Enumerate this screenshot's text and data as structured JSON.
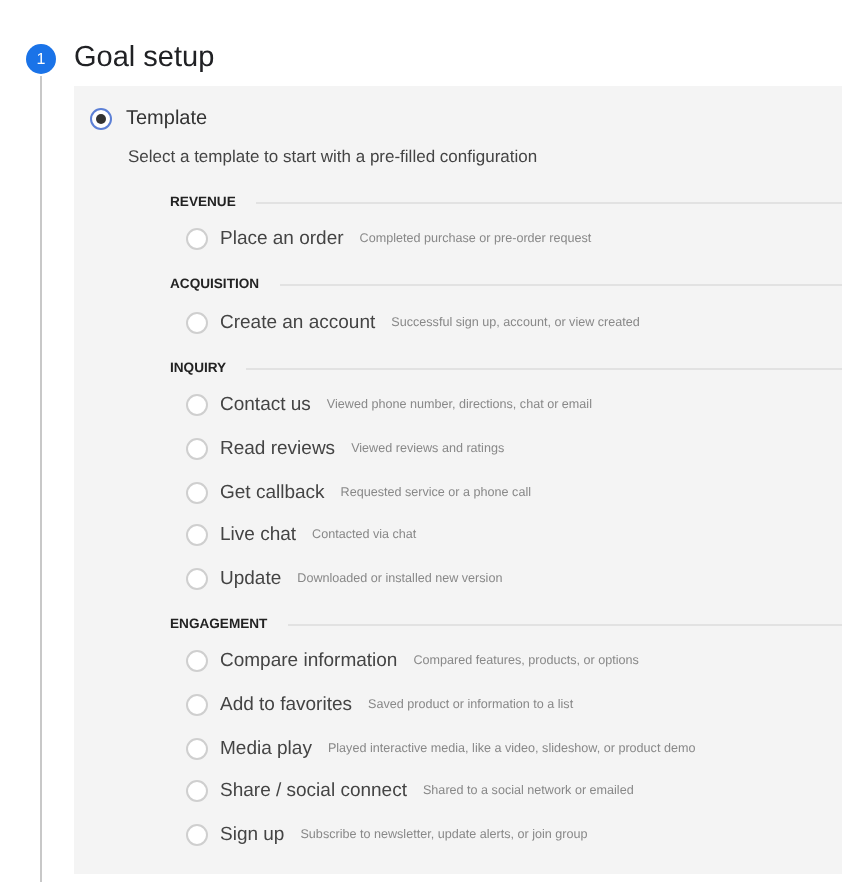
{
  "step": {
    "number": "1",
    "title": "Goal setup"
  },
  "template_option": {
    "label": "Template",
    "selected": true
  },
  "instruction": "Select a template to start with a pre-filled configuration",
  "categories": [
    {
      "title": "REVENUE",
      "options": [
        {
          "label": "Place an order",
          "description": "Completed purchase or pre-order request",
          "selected": false
        }
      ]
    },
    {
      "title": "ACQUISITION",
      "options": [
        {
          "label": "Create an account",
          "description": "Successful sign up, account, or view created",
          "selected": false
        }
      ]
    },
    {
      "title": "INQUIRY",
      "options": [
        {
          "label": "Contact us",
          "description": "Viewed phone number, directions, chat or email",
          "selected": false
        },
        {
          "label": "Read reviews",
          "description": "Viewed reviews and ratings",
          "selected": false
        },
        {
          "label": "Get callback",
          "description": "Requested service or a phone call",
          "selected": false
        },
        {
          "label": "Live chat",
          "description": "Contacted via chat",
          "selected": false
        },
        {
          "label": "Update",
          "description": "Downloaded or installed new version",
          "selected": false
        }
      ]
    },
    {
      "title": "ENGAGEMENT",
      "options": [
        {
          "label": "Compare information",
          "description": "Compared features, products, or options",
          "selected": false
        },
        {
          "label": "Add to favorites",
          "description": "Saved product or information to a list",
          "selected": false
        },
        {
          "label": "Media play",
          "description": "Played interactive media, like a video, slideshow, or product demo",
          "selected": false
        },
        {
          "label": "Share / social connect",
          "description": "Shared to a social network or emailed",
          "selected": false
        },
        {
          "label": "Sign up",
          "description": "Subscribe to newsletter, update alerts, or join group",
          "selected": false
        }
      ]
    }
  ]
}
